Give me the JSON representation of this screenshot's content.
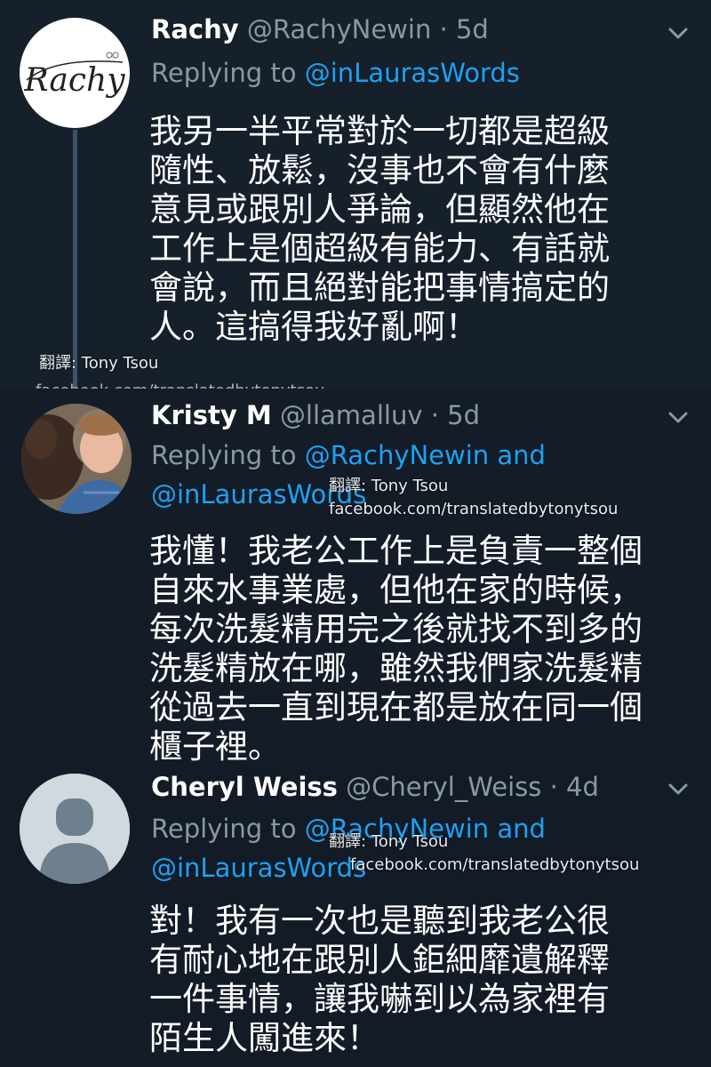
{
  "tweets": [
    {
      "display_name": "Rachy",
      "handle": "@RachyNewin",
      "separator": "·",
      "time": "5d",
      "replying_label": "Replying to",
      "reply_line1": "@inLaurasWords",
      "reply_line2": "",
      "avatar_logo_text": "Rachy",
      "body_lines": [
        "我另一半平常對於一切都是超級",
        "隨性、放鬆，沒事也不會有什麼",
        "意見或跟別人爭論，但顯然他在",
        "工作上是個超級有能力、有話就",
        "會說，而且絕對能把事情搞定的",
        "人。這搞得我好亂啊！"
      ],
      "watermark_translator": "翻譯: Tony Tsou",
      "watermark_link_cut": "facebook.com/translatedbytonytsou"
    },
    {
      "display_name": "Kristy M",
      "handle": "@llamalluv",
      "separator": "·",
      "time": "5d",
      "replying_label": "Replying to",
      "reply_line1": "@RachyNewin and",
      "reply_line2": "@inLaurasWords",
      "body_lines": [
        "我懂！我老公工作上是負責一整個",
        "自來水事業處，但他在家的時候，",
        "每次洗髮精用完之後就找不到多的",
        "洗髮精放在哪，雖然我們家洗髮精",
        "從過去一直到現在都是放在同一個",
        "櫃子裡。"
      ],
      "watermark_translator": "翻譯: Tony Tsou",
      "watermark_link": "facebook.com/translatedbytonytsou"
    },
    {
      "display_name": "Cheryl Weiss",
      "handle": "@Cheryl_Weiss",
      "separator": "·",
      "time": "4d",
      "replying_label": "Replying to",
      "reply_line1": "@RachyNewin and",
      "reply_line2": "@inLaurasWords",
      "body_lines": [
        "對！我有一次也是聽到我老公很",
        "有耐心地在跟別人鉅細靡遺解釋",
        "一件事情，讓我嚇到以為家裡有",
        "陌生人闖進來！"
      ],
      "watermark_translator": "翻譯: Tony Tsou",
      "watermark_link": "facebook.com/translatedbytonytsou"
    }
  ],
  "icons": {
    "chevron": "chevron-down-icon",
    "default_avatar": "default-avatar-icon"
  },
  "colors": {
    "background": "#141d26",
    "secondary_text": "#8899a6",
    "link": "#1da1f2",
    "primary_text": "#ffffff"
  }
}
